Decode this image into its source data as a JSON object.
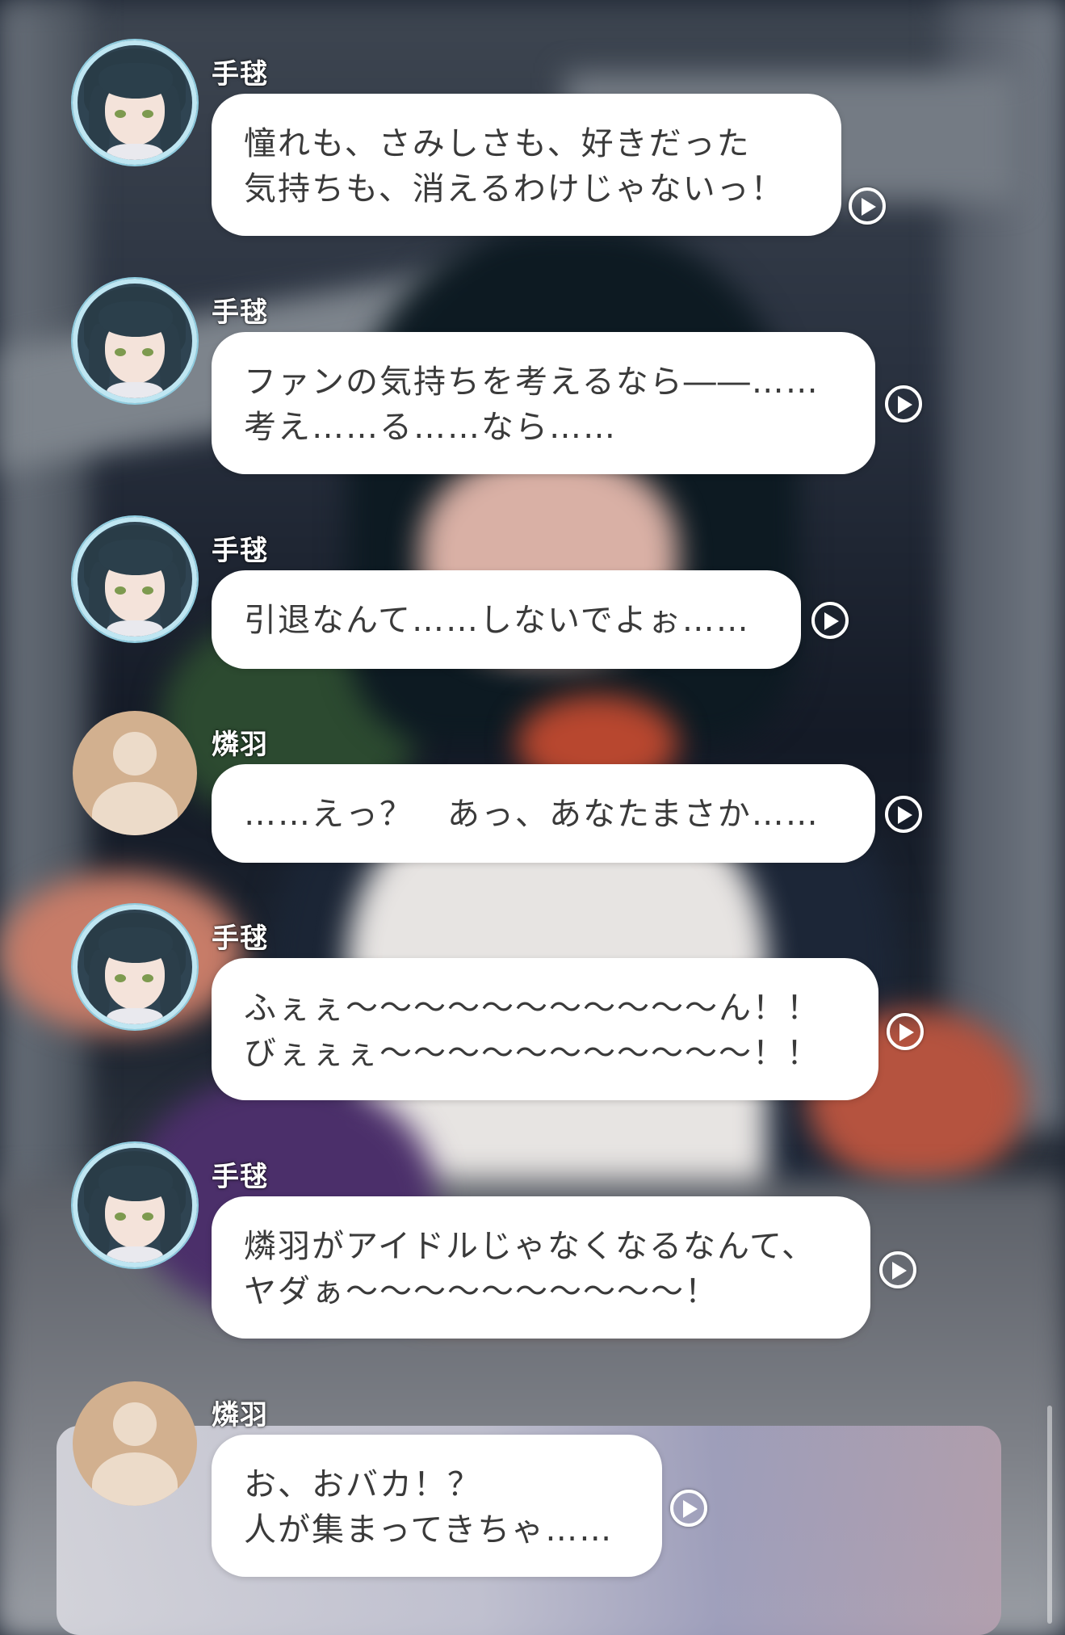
{
  "messages": [
    {
      "speaker": "手毬",
      "avatar": "character-avatar-icon",
      "text": "憧れも、さみしさも、好きだった\n気持ちも、消えるわけじゃないっ！"
    },
    {
      "speaker": "手毬",
      "avatar": "character-avatar-icon",
      "text": "ファンの気持ちを考えるなら――……\n考え……る……なら……"
    },
    {
      "speaker": "手毬",
      "avatar": "character-avatar-icon",
      "text": "引退なんて……しないでよぉ……"
    },
    {
      "speaker": "燐羽",
      "avatar": "placeholder-avatar-icon",
      "text": "……えっ？　あっ、あなたまさか……"
    },
    {
      "speaker": "手毬",
      "avatar": "character-avatar-icon",
      "text": "ふぇぇ～～～～～～～～～～～ん！！\nびぇぇぇ～～～～～～～～～～～！！"
    },
    {
      "speaker": "手毬",
      "avatar": "character-avatar-icon",
      "text": "燐羽がアイドルじゃなくなるなんて、\nヤダぁ～～～～～～～～～～！"
    },
    {
      "speaker": "燐羽",
      "avatar": "placeholder-avatar-icon",
      "text": "お、おバカ！？\n人が集まってきちゃ……"
    }
  ],
  "icons": {
    "play": "play-voice-icon"
  },
  "colors": {
    "bubble": "#ffffff",
    "text": "#3a3a3a",
    "avatar_ring": "#bfe6f2",
    "placeholder_avatar": "#d2b08f"
  }
}
